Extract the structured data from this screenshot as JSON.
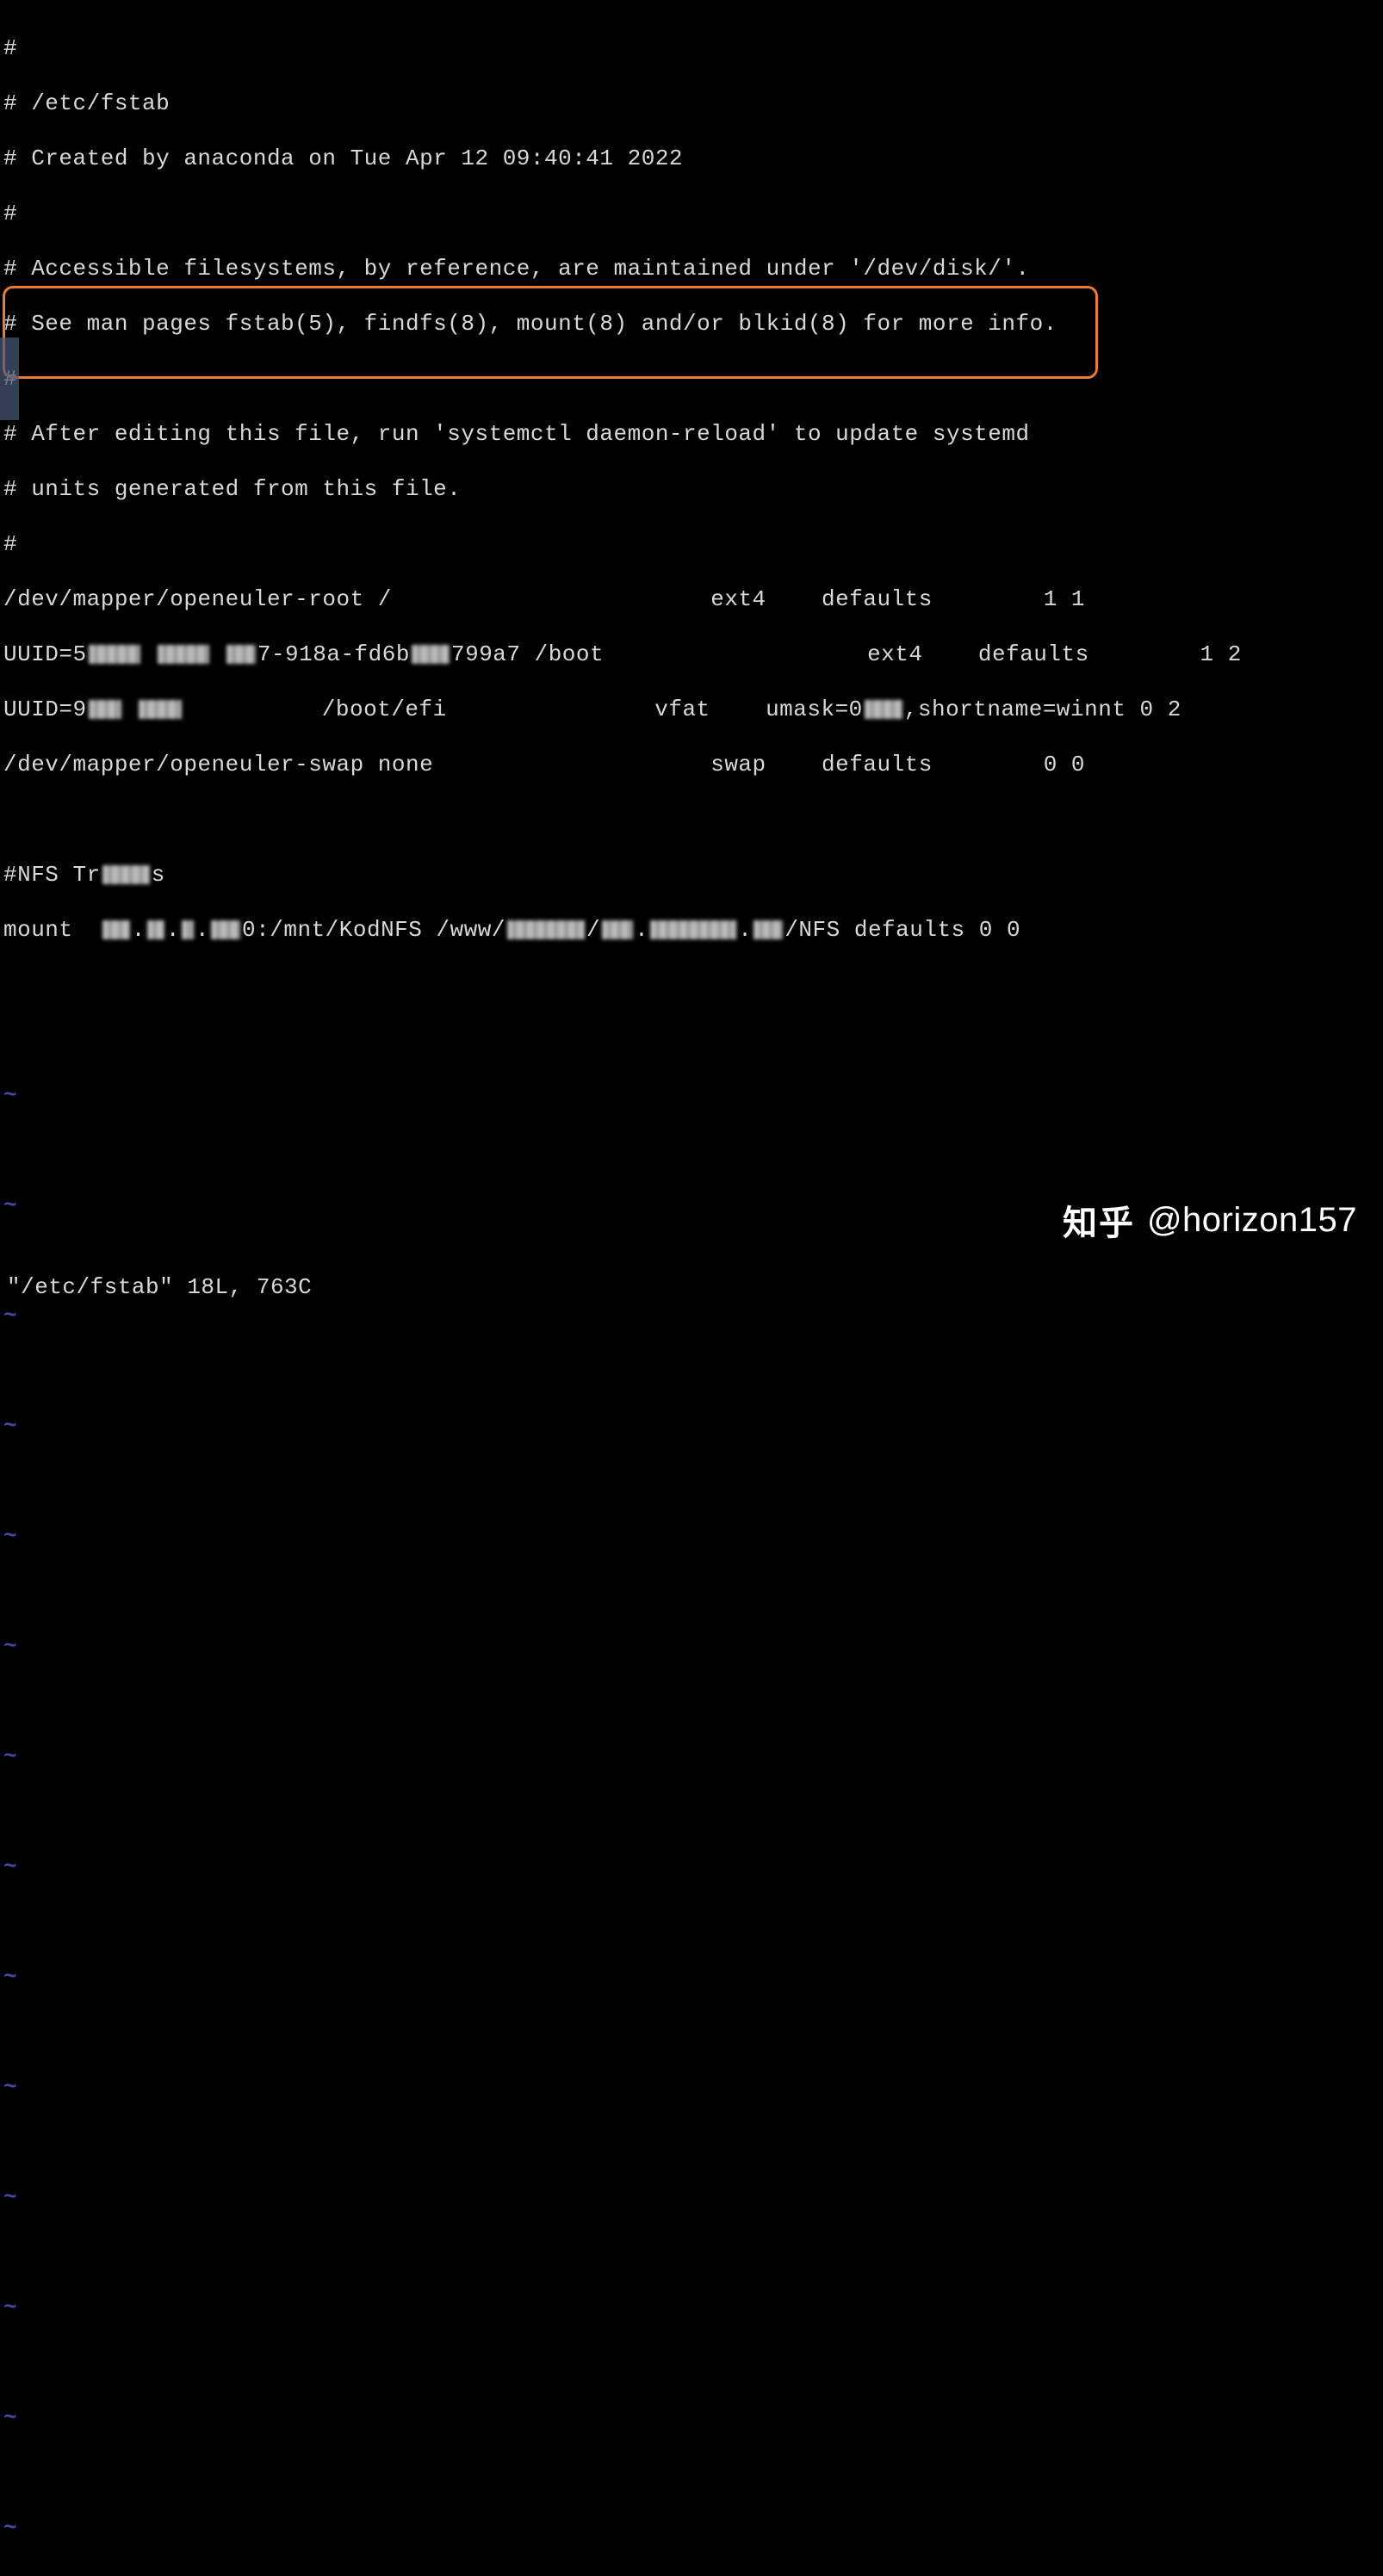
{
  "file_content": {
    "line1": "#",
    "line2": "# /etc/fstab",
    "line3": "# Created by anaconda on Tue Apr 12 09:40:41 2022",
    "line4": "#",
    "line5": "# Accessible filesystems, by reference, are maintained under '/dev/disk/'.",
    "line6": "# See man pages fstab(5), findfs(8), mount(8) and/or blkid(8) for more info.",
    "line7": "#",
    "line8": "# After editing this file, run 'systemctl daemon-reload' to update systemd",
    "line9": "# units generated from this file.",
    "line10": "#",
    "line11_a": "/dev/mapper/openeuler-root /",
    "line11_b": "ext4    defaults        1 1",
    "line12_a": "UUID=5",
    "line12_b": "7-918a-fd6b",
    "line12_c": "799a7 /boot",
    "line12_d": "ext4    defaults        1 2",
    "line13_a": "UUID=9",
    "line13_b": "/boot/efi",
    "line13_c": "vfat    umask=0",
    "line13_d": ",shortname=winnt 0 2",
    "line14": "/dev/mapper/openeuler-swap none                    swap    defaults        0 0",
    "line15_blank": "",
    "line16_a": "#NFS Tr",
    "line16_b": "s",
    "line17_a": "mount  ",
    "line17_b": "0:/mnt/KodNFS /www/",
    "line17_c": "/NFS defaults 0 0"
  },
  "tilde_char": "~",
  "status_line": "\"/etc/fstab\" 18L, 763C",
  "watermark": {
    "logo_text": "知乎",
    "user_text": "@horizon157"
  },
  "colors": {
    "highlight_border": "#e87a3c",
    "tilde_color": "#3b4db0"
  }
}
